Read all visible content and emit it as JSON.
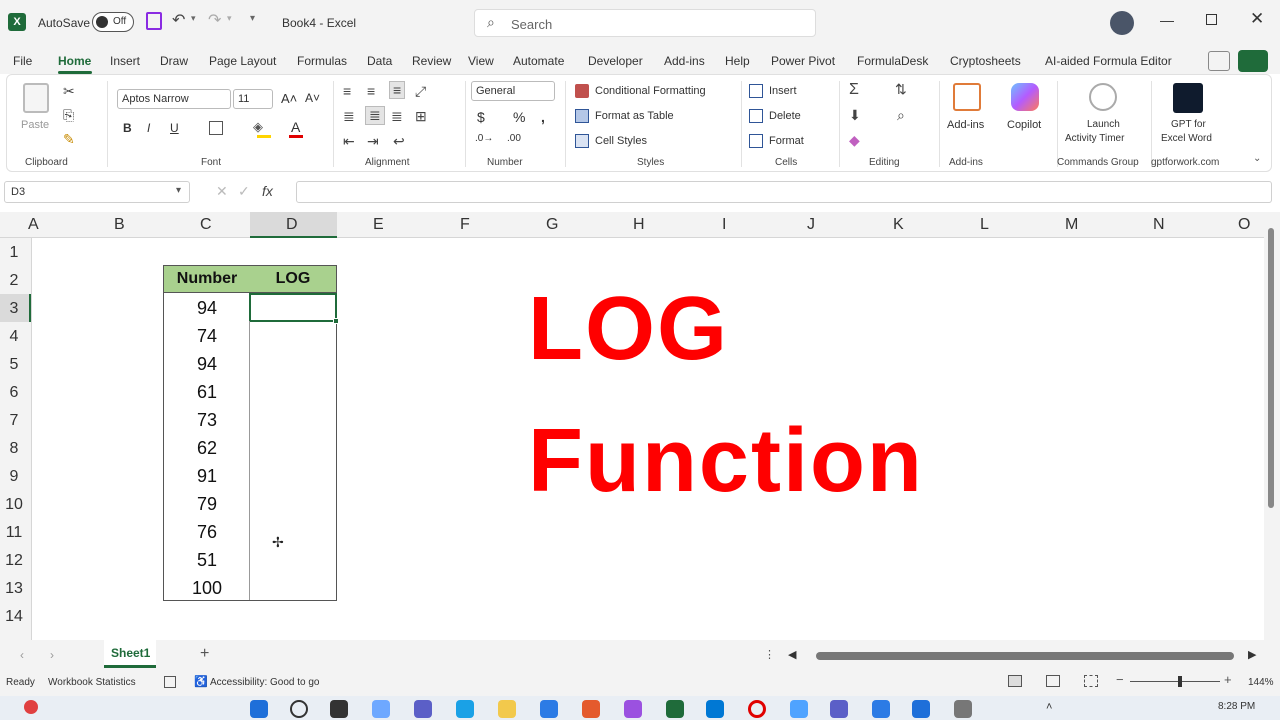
{
  "titlebar": {
    "autosave_label": "AutoSave",
    "autosave_state": "Off",
    "doc_title": "Book4 - Excel",
    "search_placeholder": "Search"
  },
  "menu": {
    "tabs": [
      "File",
      "Home",
      "Insert",
      "Draw",
      "Page Layout",
      "Formulas",
      "Data",
      "Review",
      "View",
      "Automate",
      "Developer",
      "Add-ins",
      "Help",
      "Power Pivot",
      "FormulaDesk",
      "Cryptosheets",
      "AI-aided Formula Editor"
    ],
    "active": "Home"
  },
  "ribbon": {
    "paste": "Paste",
    "font_name": "Aptos Narrow",
    "font_size": "11",
    "number_format": "General",
    "conditional_formatting": "Conditional Formatting",
    "format_as_table": "Format as Table",
    "cell_styles": "Cell Styles",
    "insert": "Insert",
    "delete": "Delete",
    "format": "Format",
    "addins": "Add-ins",
    "copilot": "Copilot",
    "launch_timer": [
      "Launch",
      "Activity Timer"
    ],
    "gpt_excel": [
      "GPT for",
      "Excel Word"
    ],
    "groups": {
      "clipboard": "Clipboard",
      "font": "Font",
      "alignment": "Alignment",
      "number": "Number",
      "styles": "Styles",
      "cells": "Cells",
      "editing": "Editing",
      "addins": "Add-ins",
      "commands": "Commands Group",
      "gpt": "gptforwork.com"
    }
  },
  "formula_bar": {
    "name_box": "D3",
    "fx": "fx"
  },
  "sheet": {
    "columns": [
      "A",
      "B",
      "C",
      "D",
      "E",
      "F",
      "G",
      "H",
      "I",
      "J",
      "K",
      "L",
      "M",
      "N",
      "O"
    ],
    "rows": [
      "1",
      "2",
      "3",
      "4",
      "5",
      "6",
      "7",
      "8",
      "9",
      "10",
      "11",
      "12",
      "13",
      "14"
    ],
    "table_headers": [
      "Number",
      "LOG"
    ],
    "numbers": [
      "94",
      "74",
      "94",
      "61",
      "73",
      "62",
      "91",
      "79",
      "76",
      "51",
      "100"
    ],
    "title_line1": "LOG",
    "title_line2": "Function"
  },
  "tabs": {
    "sheet_name": "Sheet1"
  },
  "status": {
    "ready": "Ready",
    "workbook_stats": "Workbook Statistics",
    "accessibility": "Accessibility: Good to go",
    "zoom": "144%",
    "time": "8:28 PM"
  },
  "colors": {
    "excel_green": "#1f6b3a",
    "header_fill": "#a9d18e",
    "title_red": "#ff0000"
  }
}
